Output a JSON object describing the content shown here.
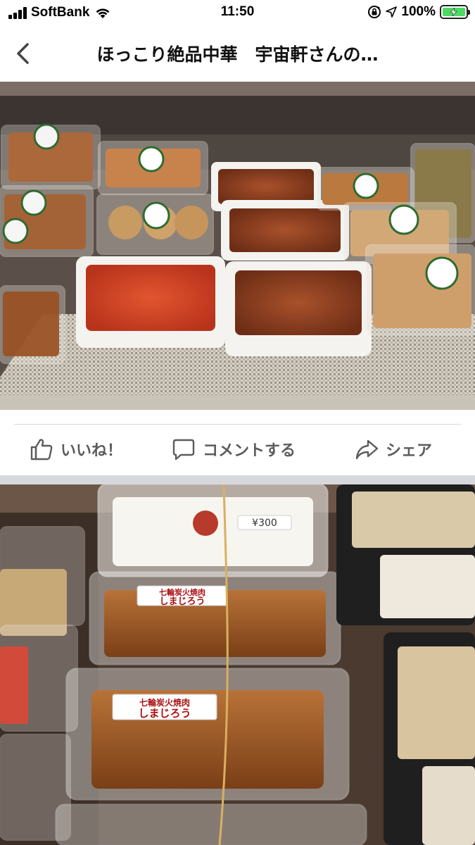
{
  "status_bar": {
    "carrier": "SoftBank",
    "time": "11:50",
    "battery_percent": "100%",
    "battery_level": 1.0,
    "signal_bars": 4
  },
  "header": {
    "title": "ほっこり絶品中華　宇宙軒さんの…",
    "back_icon": "chevron-left-icon"
  },
  "photos": [
    {
      "name": "chinese-food-takeout-display"
    },
    {
      "name": "bento-boxes-display",
      "labels": [
        "¥300",
        "七輪炭火焼肉",
        "しまじろう",
        "七輪炭火焼肉",
        "しまじろう"
      ]
    }
  ],
  "actions": {
    "like_label": "いいね！",
    "comment_label": "コメントする",
    "share_label": "シェア"
  },
  "colors": {
    "action_text": "#5c5c5c",
    "battery_fill": "#4cd964",
    "section_separator": "#d7d8dc"
  }
}
